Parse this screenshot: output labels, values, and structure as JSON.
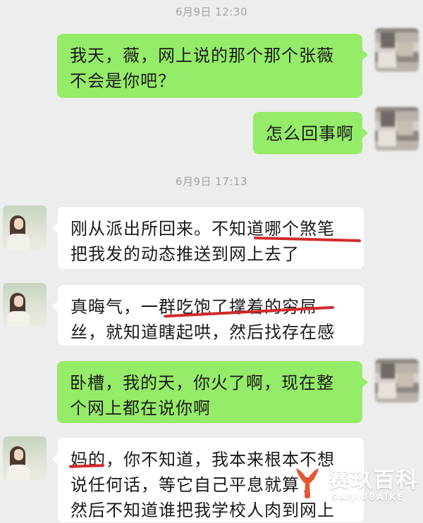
{
  "chat": {
    "timestamps": [
      "6月9日 12:30",
      "6月9日 17:13"
    ],
    "messages": [
      {
        "sender": "me",
        "lines": [
          "我天，薇，网上说的那个那个张薇",
          "不会是你吧？"
        ]
      },
      {
        "sender": "me",
        "lines": [
          "怎么回事啊"
        ]
      },
      {
        "sender": "her",
        "lines": [
          "刚从派出所回来。不知道哪个煞笔",
          "把我发的动态推送到网上去了"
        ]
      },
      {
        "sender": "her",
        "lines": [
          "真晦气，一群吃饱了撑着的穷屌",
          "丝，就知道瞎起哄，然后找存在感"
        ]
      },
      {
        "sender": "me",
        "lines": [
          "卧槽，我的天，你火了啊，现在整",
          "个网上都在说你啊"
        ]
      },
      {
        "sender": "her",
        "lines": [
          "妈的，你不知道，我本来根本不想",
          "说任何话，等它自己平息就算了",
          "然后不知道谁把我学校人肉到网上"
        ]
      }
    ]
  },
  "watermark": {
    "title": "赛玖百科",
    "subtitle": "SAIJIUBAIKE",
    "color": "#e8552f"
  },
  "colors": {
    "background": "#ededed",
    "sent_bubble": "#95ec69",
    "received_bubble": "#ffffff",
    "annotation": "#d22a2a"
  }
}
